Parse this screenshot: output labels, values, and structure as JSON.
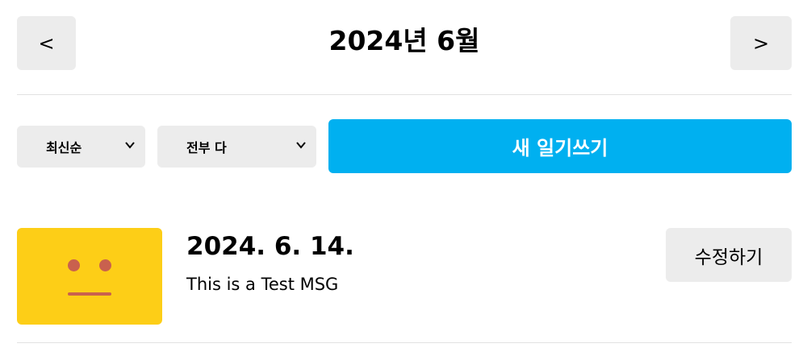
{
  "header": {
    "title": "2024년 6월",
    "prev_label": "<",
    "next_label": ">"
  },
  "controls": {
    "sort": {
      "selected": "최신순",
      "icon": "chevron-down-icon"
    },
    "filter": {
      "selected": "전부 다",
      "icon": "chevron-down-icon"
    },
    "new_button_label": "새 일기쓰기"
  },
  "diary_list": [
    {
      "emotion_icon": "neutral-face-icon",
      "emotion_color": "#fdce17",
      "date": "2024. 6. 14.",
      "content": "This is a Test MSG",
      "edit_label": "수정하기"
    }
  ],
  "colors": {
    "accent": "#00b0f0",
    "button_bg": "#ececec",
    "emotion_face": "#c9614e"
  }
}
